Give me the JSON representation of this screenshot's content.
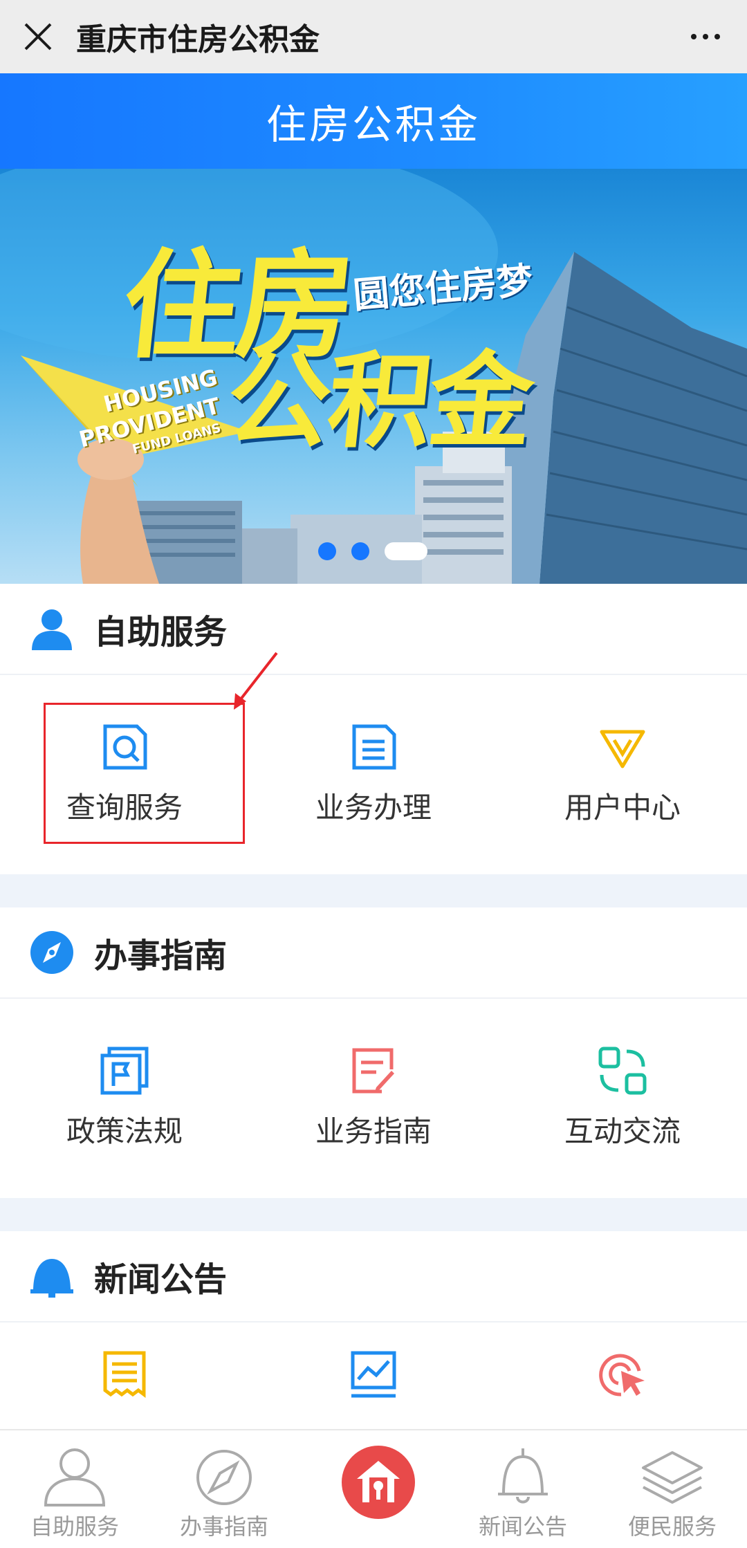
{
  "topbar": {
    "title": "重庆市住房公积金",
    "close_icon": "close-icon",
    "more_icon": "more-icon"
  },
  "header": {
    "title": "住房公积金"
  },
  "banner": {
    "headline_1": "住房",
    "headline_2": "公积金",
    "subline": "圆您住房梦",
    "en_1": "HOUSING",
    "en_2": "PROVIDENT",
    "en_3": "FUND LOANS",
    "slides": 3,
    "active_slide": 3
  },
  "sections": [
    {
      "title": "自助服务",
      "icon": "user-icon",
      "items": [
        {
          "label": "查询服务",
          "icon": "search-doc-icon",
          "color": "#1e8cf0"
        },
        {
          "label": "业务办理",
          "icon": "document-icon",
          "color": "#1e8cf0"
        },
        {
          "label": "用户中心",
          "icon": "diamond-icon",
          "color": "#f5b800"
        }
      ]
    },
    {
      "title": "办事指南",
      "icon": "compass-icon",
      "items": [
        {
          "label": "政策法规",
          "icon": "flag-icon",
          "color": "#1e8cf0"
        },
        {
          "label": "业务指南",
          "icon": "edit-doc-icon",
          "color": "#f06b6b"
        },
        {
          "label": "互动交流",
          "icon": "exchange-icon",
          "color": "#1cbfa0"
        }
      ]
    },
    {
      "title": "新闻公告",
      "icon": "bell-icon",
      "items": [
        {
          "label": "",
          "icon": "receipt-icon",
          "color": "#f5b800"
        },
        {
          "label": "",
          "icon": "chart-icon",
          "color": "#1e8cf0"
        },
        {
          "label": "",
          "icon": "target-click-icon",
          "color": "#f06b6b"
        }
      ]
    }
  ],
  "tabbar": [
    {
      "label": "自助服务",
      "icon": "person-outline-icon"
    },
    {
      "label": "办事指南",
      "icon": "compass-outline-icon"
    },
    {
      "label": "",
      "icon": "home-icon"
    },
    {
      "label": "新闻公告",
      "icon": "bell-outline-icon"
    },
    {
      "label": "便民服务",
      "icon": "layers-icon"
    }
  ],
  "colors": {
    "accent": "#1677ff",
    "highlight": "#e8252b",
    "home": "#e84a4a"
  }
}
